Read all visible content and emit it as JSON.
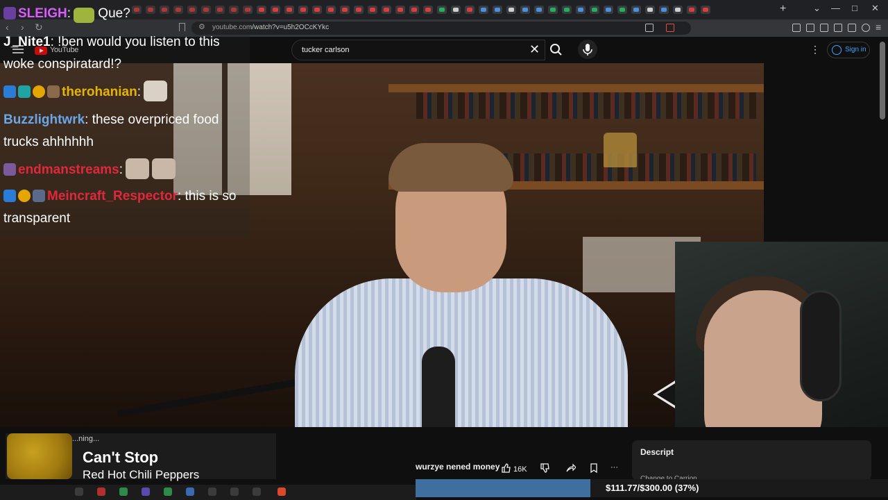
{
  "browser": {
    "url": "youtube.com/watch?v=u5h2OCcKYkc",
    "window_controls": {
      "minimize": "—",
      "maximize": "□",
      "close": "✕"
    },
    "new_tab": "+"
  },
  "youtube": {
    "logo_text": "YouTube",
    "search": {
      "value": "tucker carlson",
      "clear": "✕"
    },
    "more": "⋮",
    "signin_label": "Sign in"
  },
  "chat": {
    "messages": [
      {
        "user": "SLEIGH",
        "user_color": "#d85cff",
        "text": "Que?"
      },
      {
        "user": "J_Nite1",
        "user_color": "#ffffff",
        "text": "!ben would you listen to this woke conspiratard!?"
      },
      {
        "user": "therohanian",
        "user_color": "#e6b400",
        "text": ""
      },
      {
        "user": "Buzzlightwrk",
        "user_color": "#6aa7e8",
        "text": "these overpriced food trucks ahhhhhh"
      },
      {
        "user": "endmanstreams",
        "user_color": "#e0283c",
        "text": ""
      },
      {
        "user": "Meincraft_Respector",
        "user_color": "#e0283c",
        "text": "this is so transparent"
      }
    ]
  },
  "video_page": {
    "title": "wurzye nened money",
    "like_count": "16K",
    "more": "···",
    "description_label": "Descript",
    "description_sub": "Change to Carrion"
  },
  "now_playing": {
    "status": "...ning...",
    "title": "Can't Stop",
    "artist": "Red Hot Chili Peppers"
  },
  "goal": {
    "text": "$111.77/$300.00 (37%)",
    "progress": 0.37
  },
  "colors": {
    "youtube_red": "#ff0000",
    "accent_blue": "#3ea6ff",
    "goal_fill": "#3f6f9e"
  }
}
